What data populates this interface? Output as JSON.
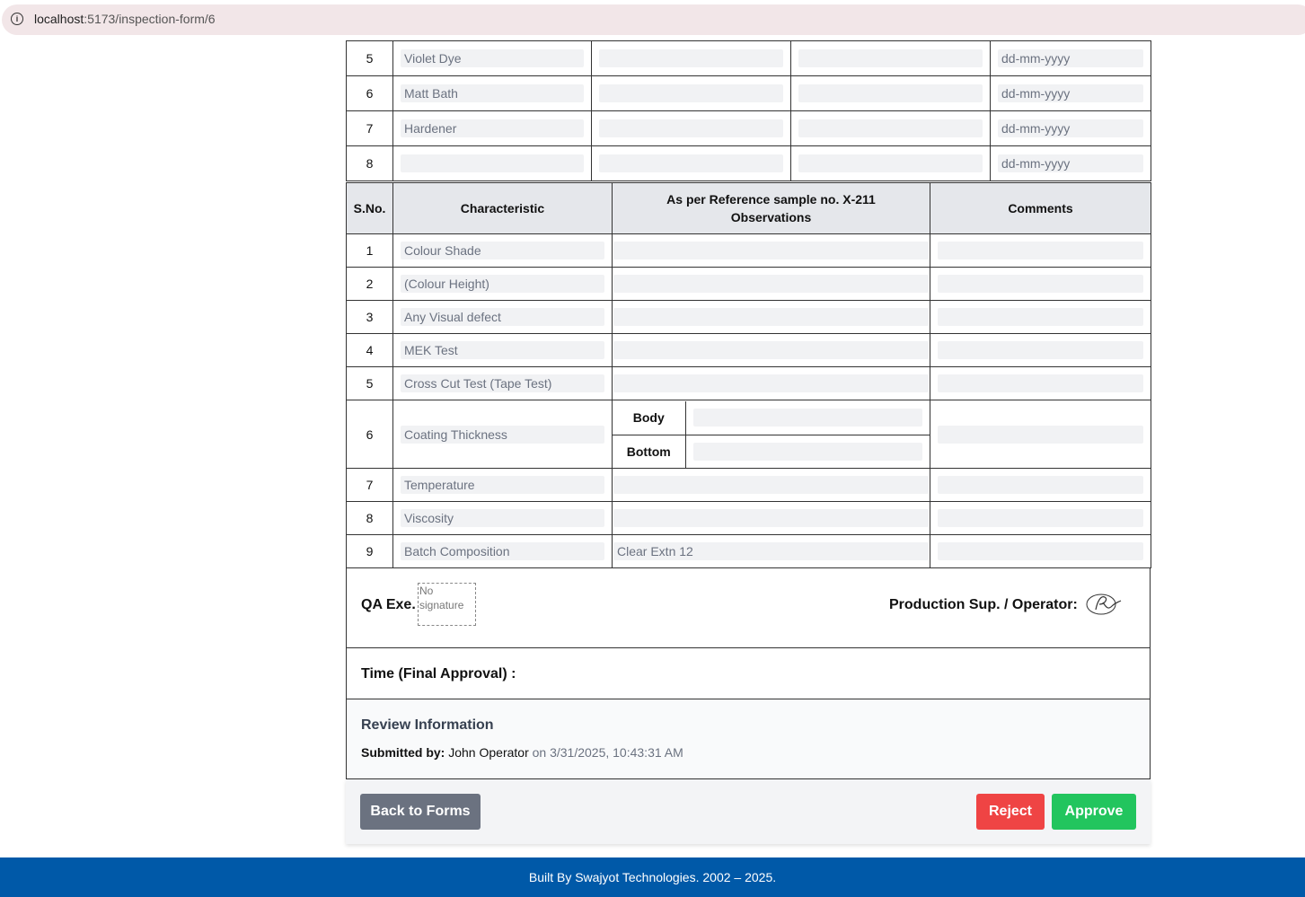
{
  "browser": {
    "url_host": "localhost",
    "url_path": ":5173/inspection-form/6"
  },
  "chemicals": [
    {
      "sno": "5",
      "name": "Violet Dye",
      "date_placeholder": "dd-mm-yyyy"
    },
    {
      "sno": "6",
      "name": "Matt Bath",
      "date_placeholder": "dd-mm-yyyy"
    },
    {
      "sno": "7",
      "name": "Hardener",
      "date_placeholder": "dd-mm-yyyy"
    },
    {
      "sno": "8",
      "name": "",
      "date_placeholder": "dd-mm-yyyy"
    }
  ],
  "characteristics": {
    "headers": {
      "sno": "S.No.",
      "characteristic": "Characteristic",
      "observations_line1": "As per Reference sample no. X-211",
      "observations_line2": "Observations",
      "comments": "Comments"
    },
    "rows": [
      {
        "sno": "1",
        "name": "Colour Shade",
        "observation": ""
      },
      {
        "sno": "2",
        "name": "(Colour Height)",
        "observation": ""
      },
      {
        "sno": "3",
        "name": "Any Visual defect",
        "observation": ""
      },
      {
        "sno": "4",
        "name": "MEK Test",
        "observation": ""
      },
      {
        "sno": "5",
        "name": "Cross Cut Test (Tape Test)",
        "observation": ""
      },
      {
        "sno": "6",
        "name": "Coating Thickness",
        "sub_body": "Body",
        "sub_bottom": "Bottom"
      },
      {
        "sno": "7",
        "name": "Temperature",
        "observation": ""
      },
      {
        "sno": "8",
        "name": "Viscosity",
        "observation": ""
      },
      {
        "sno": "9",
        "name": "Batch Composition",
        "observation": "Clear Extn 12"
      }
    ]
  },
  "signatures": {
    "qa_label": "QA Exe.",
    "qa_placeholder": "No signature",
    "production_label": "Production Sup. / Operator:"
  },
  "time_label": "Time (Final Approval) :",
  "review": {
    "title": "Review Information",
    "submitted_label": "Submitted by:",
    "submitted_by": "John Operator",
    "submitted_on": "on 3/31/2025, 10:43:31 AM"
  },
  "actions": {
    "back": "Back to Forms",
    "reject": "Reject",
    "approve": "Approve"
  },
  "footer": "Built By Swajyot Technologies. 2002 – 2025."
}
